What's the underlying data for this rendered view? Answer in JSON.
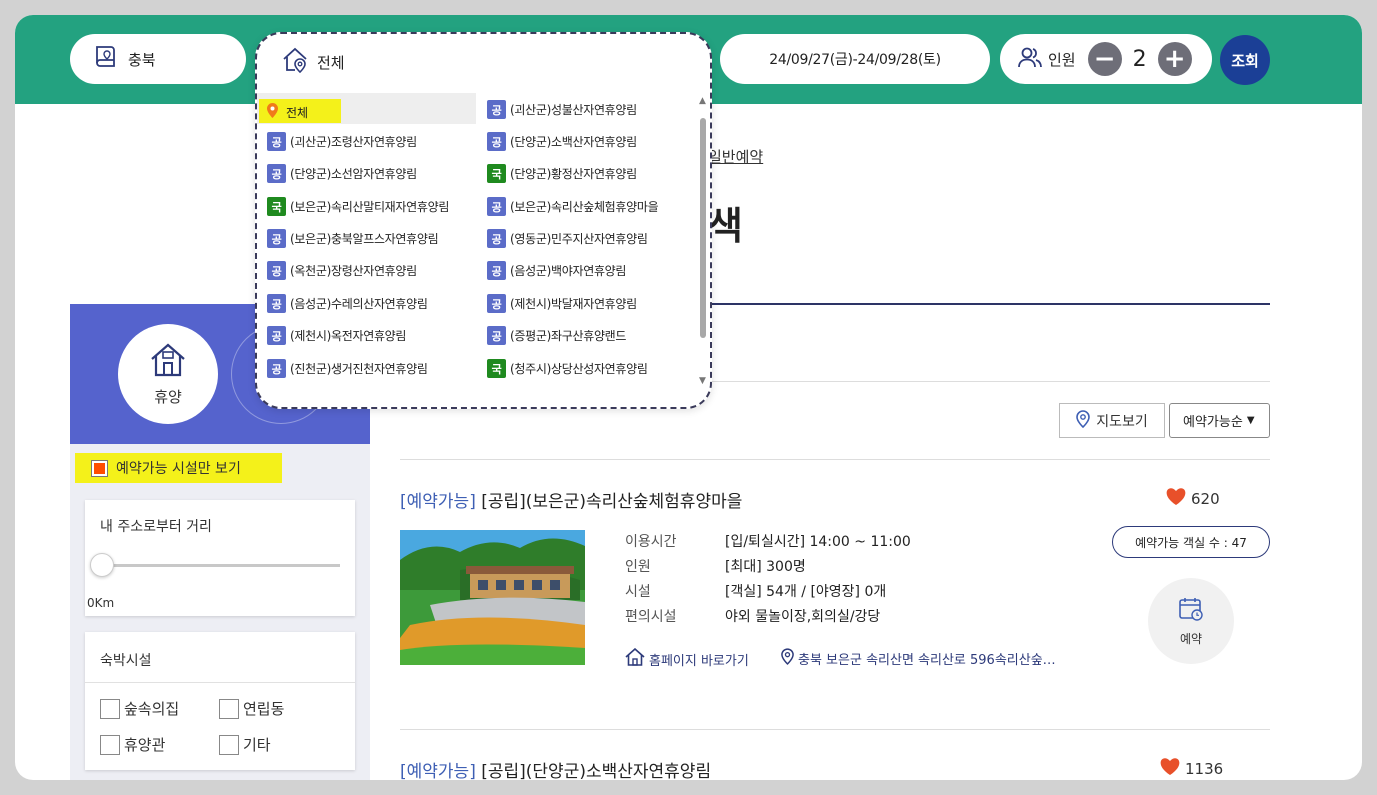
{
  "search_bar": {
    "region_label": "충북",
    "facility_label": "전체",
    "date_range": "24/09/27(금)-24/09/28(토)",
    "people_label": "인원",
    "people_count": "2",
    "minus_symbol": "−",
    "plus_symbol": "+",
    "search_label": "조회"
  },
  "page": {
    "breadcrumb_tail": "일반예약",
    "title_fragment": "색"
  },
  "sidebar": {
    "category_label": "휴양",
    "available_only_label": "예약가능 시설만 보기",
    "distance_title": "내 주소로부터 거리",
    "distance_value": "0Km",
    "lodging_title": "숙박시설",
    "lodging_options": [
      "숲속의집",
      "연립동",
      "휴양관",
      "기타"
    ]
  },
  "toolbar": {
    "map_view_label": "지도보기",
    "sort_label": "예약가능순"
  },
  "results": [
    {
      "status": "[예약가능]",
      "name": "[공립](보은군)속리산숲체험휴양마을",
      "likes": "620",
      "time_label": "이용시간",
      "time_value": "[입/퇴실시간] 14:00 ~ 11:00",
      "people_label": "인원",
      "people_value": "[최대] 300명",
      "facility_label": "시설",
      "facility_value": "[객실] 54개 / [야영장] 0개",
      "amenity_label": "편의시설",
      "amenity_value": "야외 물놀이장,회의실/강당",
      "rooms_available": "예약가능 객실 수 : 47",
      "book_label": "예약",
      "homepage_label": "홈페이지 바로가기",
      "address": "충북 보은군 속리산면 속리산로 596속리산숲…"
    },
    {
      "status": "[예약가능]",
      "name": "[공립](단양군)소백산자연휴양림",
      "likes": "1136"
    }
  ],
  "dropdown": {
    "selected": "전체",
    "options": [
      {
        "tag": "공",
        "name": "(괴산군)성불산자연휴양림"
      },
      {
        "tag": "공",
        "name": "(괴산군)조령산자연휴양림"
      },
      {
        "tag": "공",
        "name": "(단양군)소백산자연휴양림"
      },
      {
        "tag": "공",
        "name": "(단양군)소선암자연휴양림"
      },
      {
        "tag": "국",
        "name": "(단양군)황정산자연휴양림"
      },
      {
        "tag": "국",
        "name": "(보은군)속리산말티재자연휴양림"
      },
      {
        "tag": "공",
        "name": "(보은군)속리산숲체험휴양마을"
      },
      {
        "tag": "공",
        "name": "(보은군)충북알프스자연휴양림"
      },
      {
        "tag": "공",
        "name": "(영동군)민주지산자연휴양림"
      },
      {
        "tag": "공",
        "name": "(옥천군)장령산자연휴양림"
      },
      {
        "tag": "공",
        "name": "(음성군)백야자연휴양림"
      },
      {
        "tag": "공",
        "name": "(음성군)수레의산자연휴양림"
      },
      {
        "tag": "공",
        "name": "(제천시)박달재자연휴양림"
      },
      {
        "tag": "공",
        "name": "(제천시)옥전자연휴양림"
      },
      {
        "tag": "공",
        "name": "(증평군)좌구산휴양랜드"
      },
      {
        "tag": "공",
        "name": "(진천군)생거진천자연휴양림"
      },
      {
        "tag": "국",
        "name": "(청주시)상당산성자연휴양림"
      }
    ]
  },
  "colors": {
    "header_green": "#23a280",
    "sidebar_blue": "#5563cd",
    "search_navy": "#1b3f96",
    "highlight_yellow": "#f4f11a",
    "status_blue": "#3e5fb4",
    "heart_red": "#e8502a",
    "public_tag": "#5b6cc8",
    "national_tag": "#1f8a1f"
  },
  "icons": [
    "map-book-icon",
    "location-home-icon",
    "people-icon",
    "house-icon",
    "location-pin-icon",
    "heart-icon",
    "calendar-icon",
    "home-icon"
  ]
}
